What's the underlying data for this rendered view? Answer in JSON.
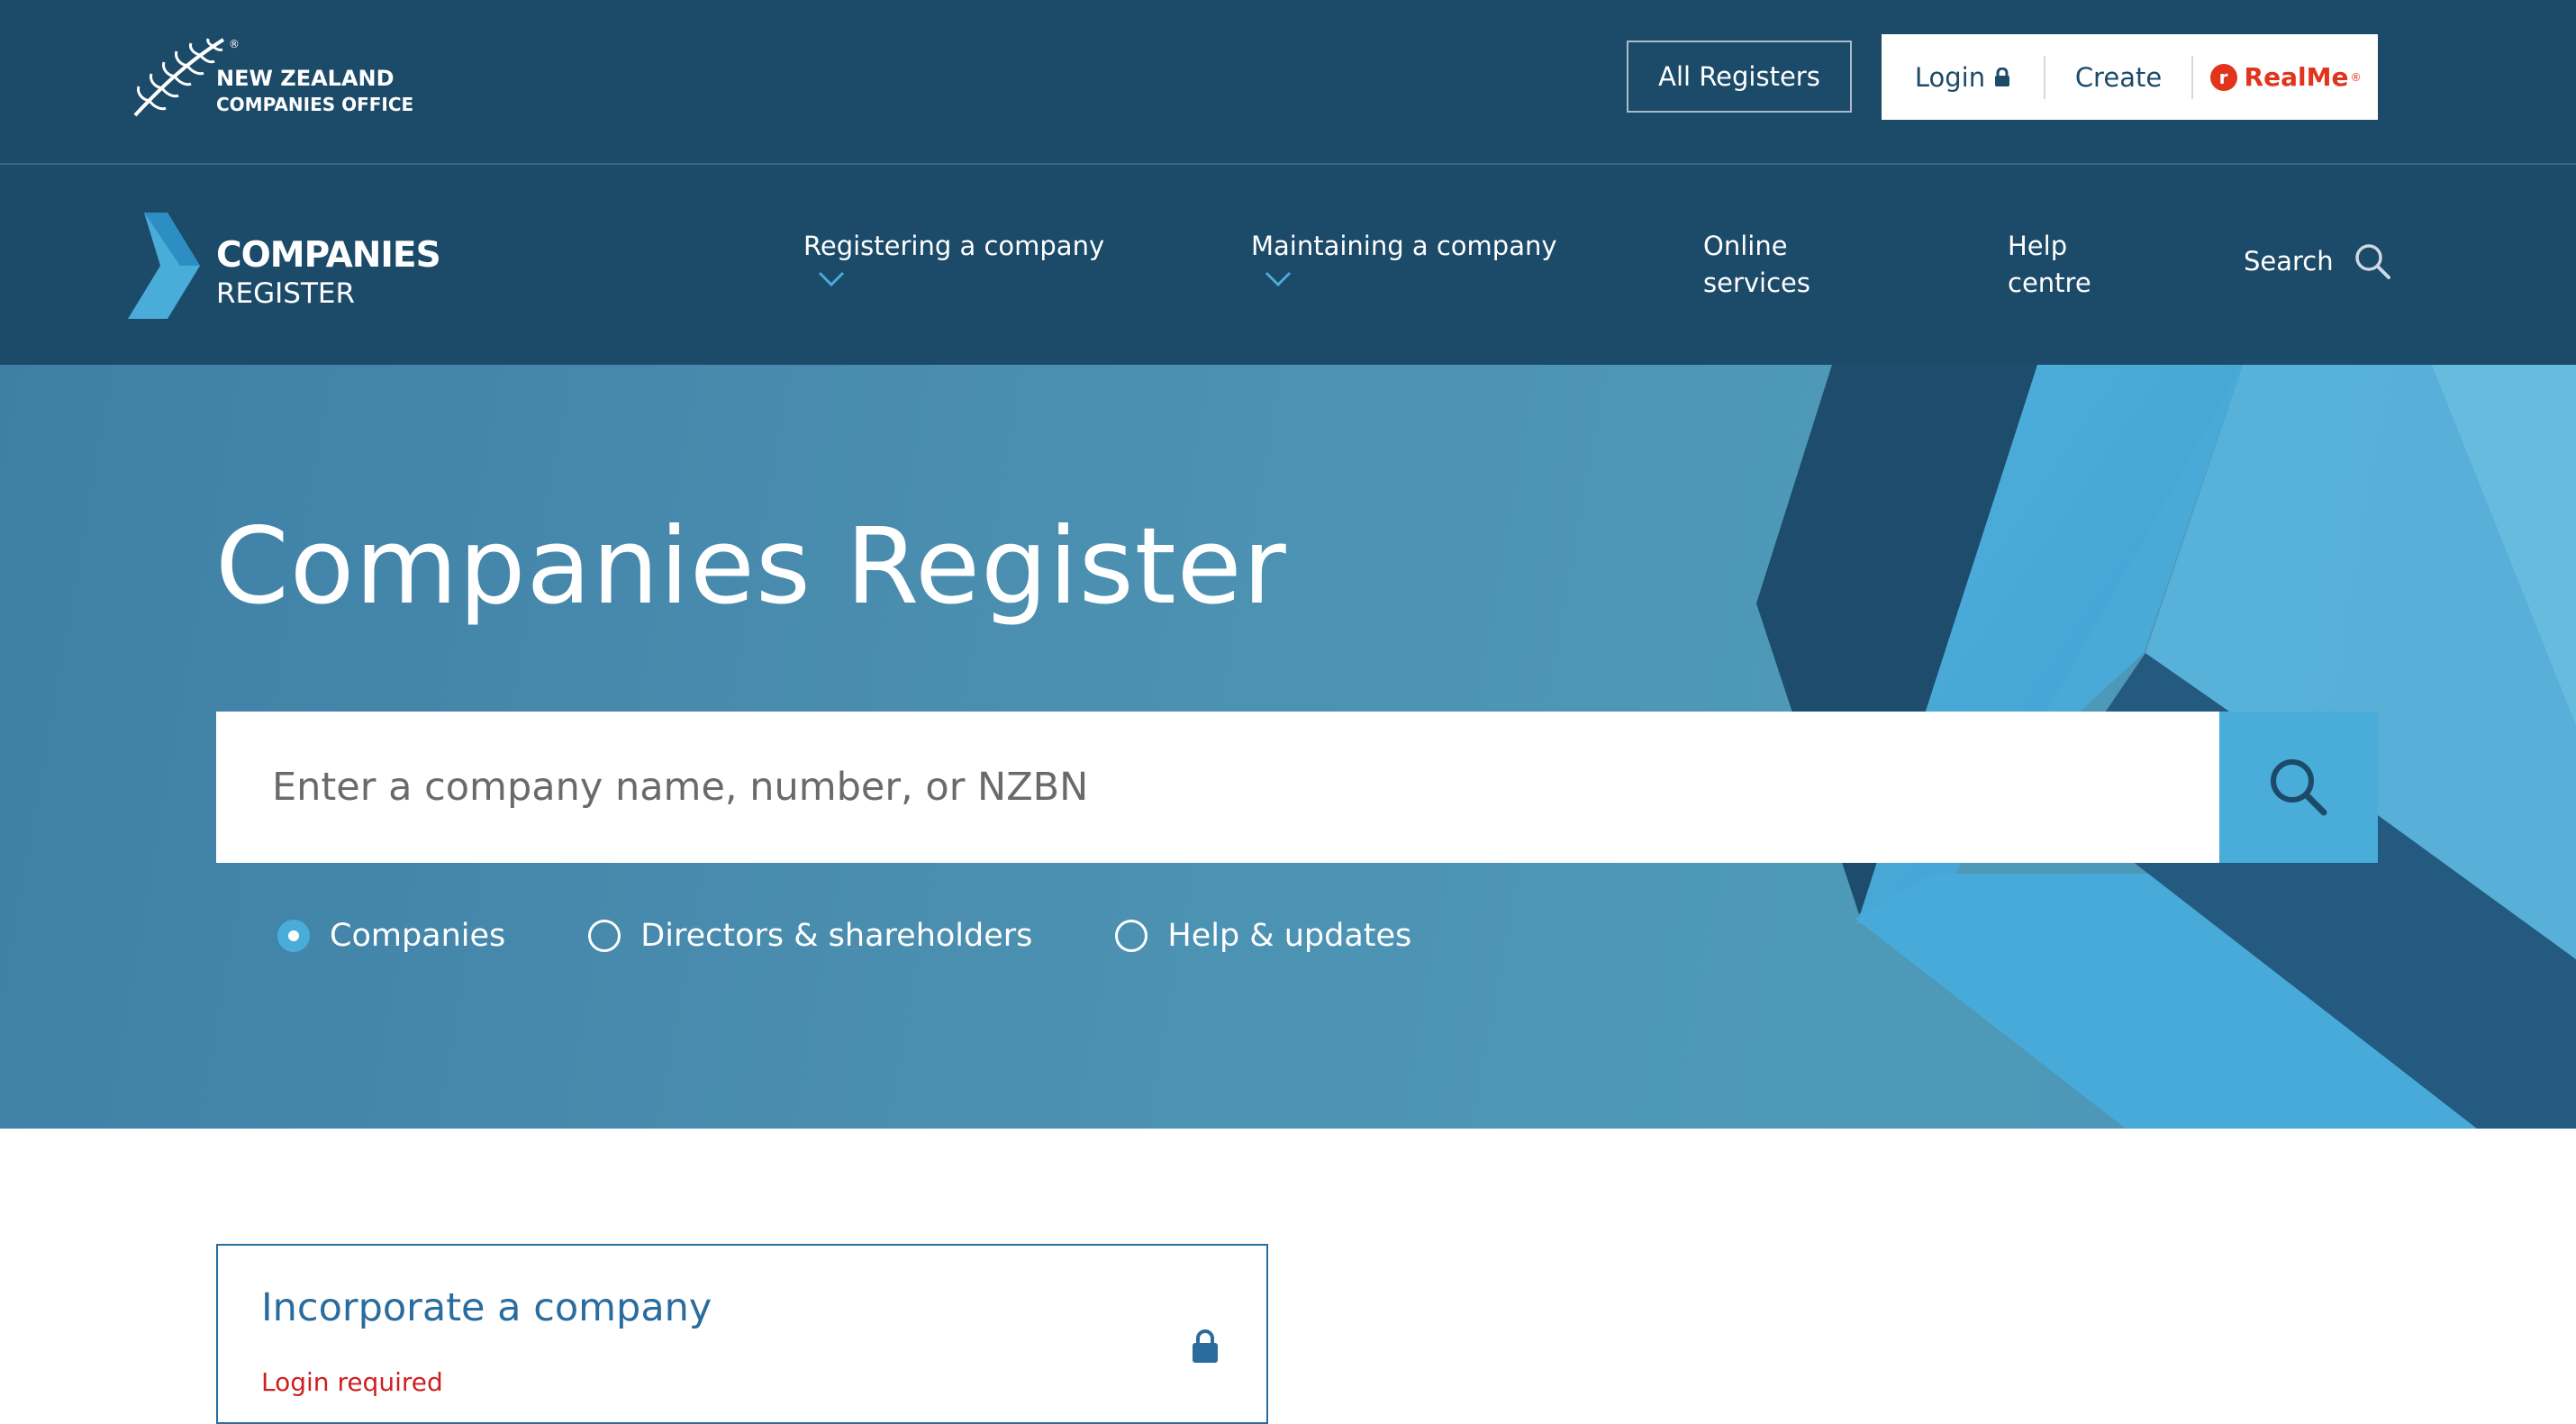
{
  "header": {
    "org_logo_line1": "NEW ZEALAND",
    "org_logo_line2": "COMPANIES OFFICE",
    "org_logo_registered": "®",
    "all_registers_label": "All Registers",
    "login_label": "Login",
    "create_label": "Create",
    "realme_label": "RealMe",
    "realme_registered": "®"
  },
  "nav": {
    "brand_line1": "COMPANIES",
    "brand_line2": "REGISTER",
    "items": [
      {
        "label": "Registering a company",
        "has_dropdown": true
      },
      {
        "label": "Maintaining a company",
        "has_dropdown": true
      },
      {
        "label_line1": "Online",
        "label_line2": "services",
        "has_dropdown": false
      },
      {
        "label_line1": "Help",
        "label_line2": "centre",
        "has_dropdown": false
      }
    ],
    "search_label": "Search"
  },
  "hero": {
    "title": "Companies Register",
    "search_placeholder": "Enter a company name, number, or NZBN",
    "search_value": "",
    "search_type_options": [
      {
        "label": "Companies",
        "selected": true
      },
      {
        "label": "Directors & shareholders",
        "selected": false
      },
      {
        "label": "Help & updates",
        "selected": false
      }
    ]
  },
  "cards": [
    {
      "title": "Incorporate a company",
      "note": "Login required",
      "locked": true
    }
  ],
  "colors": {
    "navy": "#1c4a69",
    "hero_blue": "#4b8fb0",
    "accent_light_blue": "#4aacd8",
    "realme_red": "#e0341c",
    "card_title_blue": "#2a6c9d",
    "login_required_red": "#cc2020"
  },
  "icons": {
    "fern": "fern-icon",
    "lock": "lock-icon",
    "search": "search-icon",
    "chevron": "chevron-down-icon",
    "realme": "realme-icon"
  }
}
